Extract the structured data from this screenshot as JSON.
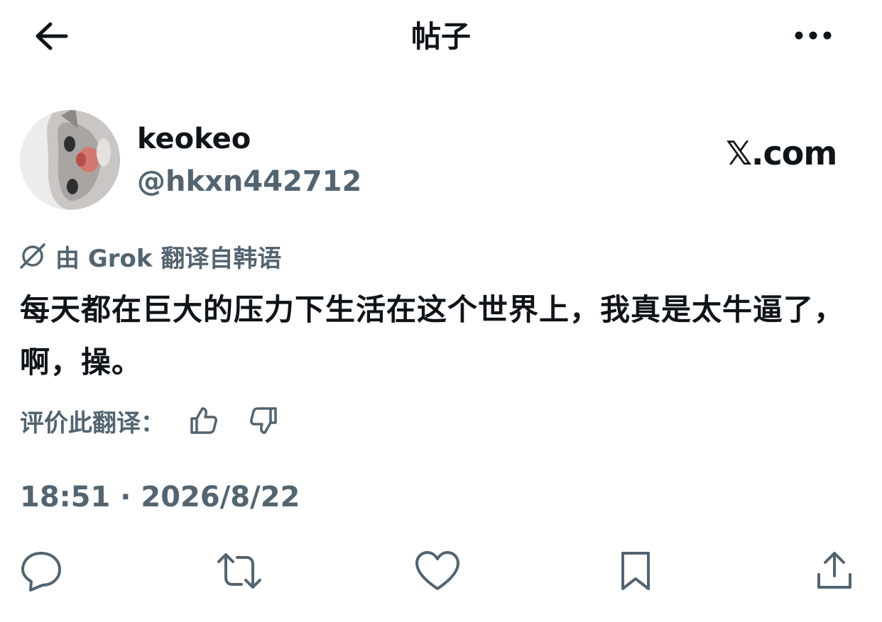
{
  "header": {
    "title": "帖子",
    "back_icon": "arrow-left-icon",
    "more_icon": "more-horizontal-icon"
  },
  "author": {
    "display_name": "keokeo",
    "handle": "@hkxn442712",
    "avatar_icon": "cat-avatar-image"
  },
  "watermark": "𝕏.com",
  "translation": {
    "note": "由 Grok 翻译自韩语",
    "icon": "grok-icon"
  },
  "post": {
    "text": "每天都在巨大的压力下生活在这个世界上，我真是太牛逼了，啊，操。"
  },
  "rate": {
    "label": "评价此翻译：",
    "thumbs_up_icon": "thumbs-up-icon",
    "thumbs_down_icon": "thumbs-down-icon"
  },
  "timestamp": "18:51 · 2026/8/22",
  "actions": [
    "reply-icon",
    "repost-icon",
    "like-icon",
    "bookmark-icon",
    "share-icon"
  ],
  "colors": {
    "text": "#0f1419",
    "secondary": "#536471",
    "background": "#ffffff"
  }
}
